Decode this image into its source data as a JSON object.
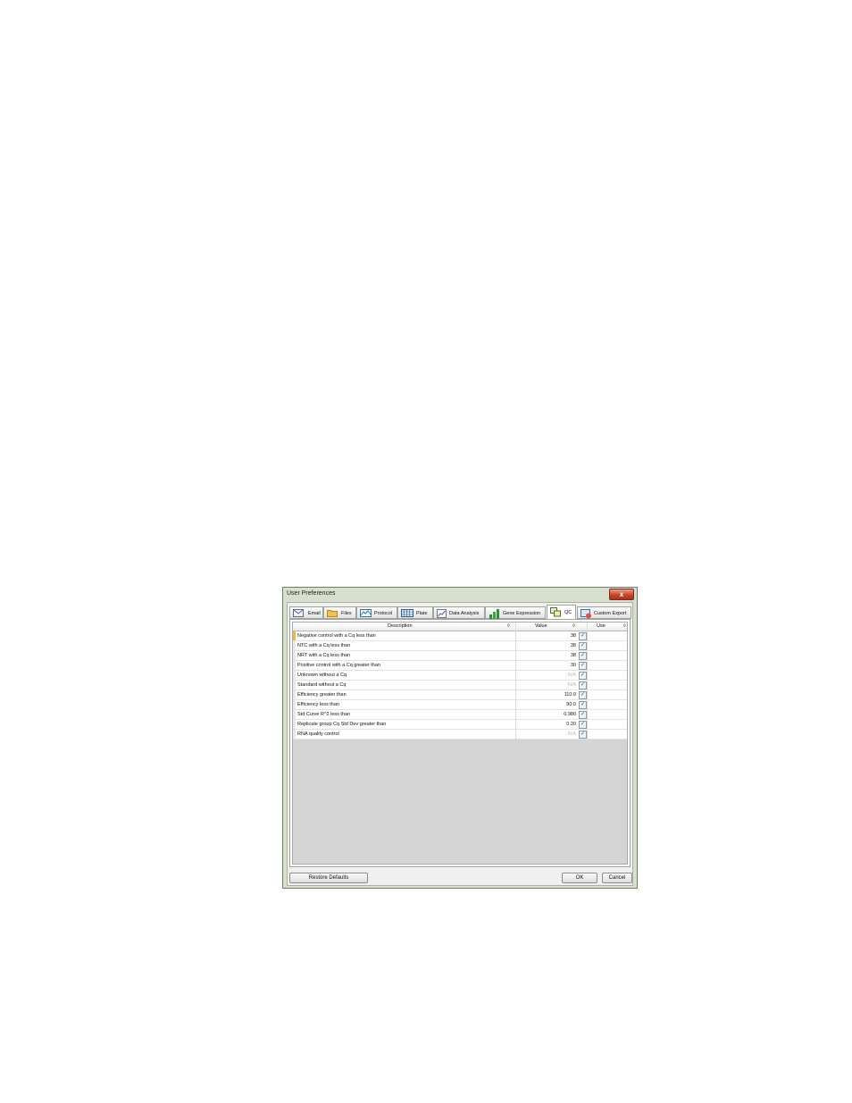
{
  "window": {
    "title": "User Preferences",
    "close_glyph": "x"
  },
  "tabs": [
    {
      "label": "Email",
      "icon": "email-icon"
    },
    {
      "label": "Files",
      "icon": "folder-icon"
    },
    {
      "label": "Protocol",
      "icon": "protocol-icon"
    },
    {
      "label": "Plate",
      "icon": "plate-icon"
    },
    {
      "label": "Data Analysis",
      "icon": "data-analysis-icon"
    },
    {
      "label": "Gene Expression",
      "icon": "bar-chart-icon"
    },
    {
      "label": "QC",
      "icon": "qc-icon",
      "active": true
    },
    {
      "label": "Custom Export",
      "icon": "custom-export-icon"
    }
  ],
  "table": {
    "columns": {
      "description": "Description",
      "value": "Value",
      "use": "Use",
      "sort_glyph": "◊"
    },
    "rows": [
      {
        "description": "Negative control with a Cq less than",
        "value": "38",
        "use": "✓"
      },
      {
        "description": "NTC with a Cq less than",
        "value": "38",
        "use": "✓"
      },
      {
        "description": "NRT with a Cq less than",
        "value": "38",
        "use": "✓"
      },
      {
        "description": "Positive control with a Cq greater than",
        "value": "30",
        "use": "✓"
      },
      {
        "description": "Unknown without a Cq",
        "value": "N/A",
        "use": "✓"
      },
      {
        "description": "Standard without a Cq",
        "value": "N/A",
        "use": "✓"
      },
      {
        "description": "Efficiency greater than",
        "value": "110.0",
        "use": "✓"
      },
      {
        "description": "Efficiency less than",
        "value": "90.0",
        "use": "✓"
      },
      {
        "description": "Std Curve R^2 less than",
        "value": "0.980",
        "use": "✓"
      },
      {
        "description": "Replicate group Cq Std Dev greater than",
        "value": "0.20",
        "use": "✓"
      },
      {
        "description": "RNA quality control",
        "value": "N/A",
        "use": "✓"
      }
    ]
  },
  "buttons": {
    "restore": "Restore Defaults",
    "ok": "OK",
    "cancel": "Cancel"
  },
  "colors": {
    "frame": "#d7dfcd",
    "current_row_marker": "#f3b440",
    "close": "#c8452a"
  }
}
